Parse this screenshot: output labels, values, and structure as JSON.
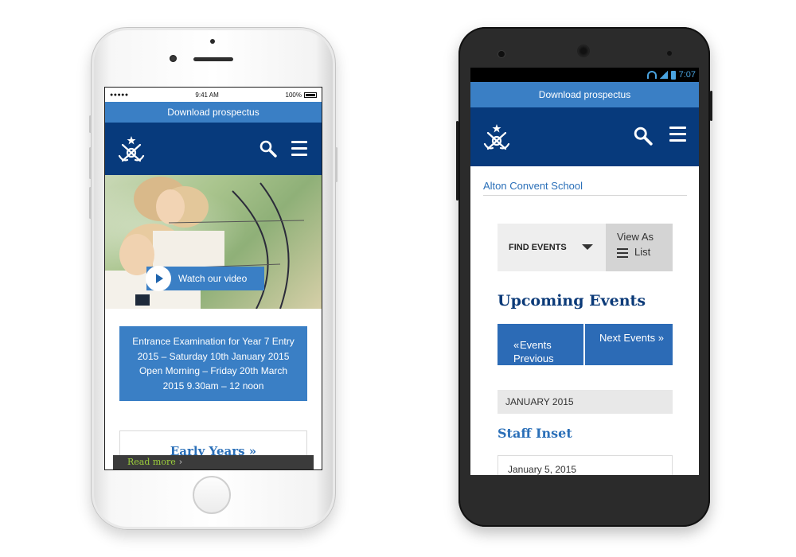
{
  "iphone": {
    "status": {
      "signal": "●●●●● ",
      "time": "9:41 AM",
      "battery": "100%"
    },
    "prospectus_label": "Download prospectus",
    "video_label": "Watch our video",
    "notice_lines": [
      "Entrance Examination for Year 7 Entry 2015 – Saturday 10th January 2015",
      "Open Morning – Friday 20th March 2015 9.30am – 12 noon"
    ],
    "early_years_label": "Early Years »",
    "read_more_label": "Read more",
    "read_more_arrow": "›"
  },
  "android": {
    "status": {
      "time": "7:07"
    },
    "prospectus_label": "Download prospectus",
    "school_name": "Alton Convent School",
    "find_events_label": "FIND EVENTS",
    "view_as_label": "View As",
    "list_label": "List",
    "upcoming_title": "Upcoming Events",
    "prev_label_1": "« Previous",
    "prev_label_2": "Events",
    "next_label": "Next Events »",
    "month_label": "JANUARY 2015",
    "event_title": "Staff Inset",
    "event_date": "January 5, 2015"
  },
  "colors": {
    "navy": "#073a7c",
    "accent_blue": "#3a7fc5",
    "link_blue": "#2a6fb8",
    "read_more_green": "#9ccf3a"
  },
  "icons": [
    "crest-logo-icon",
    "search-icon",
    "hamburger-menu-icon",
    "play-icon",
    "list-icon",
    "dropdown-arrow-icon"
  ]
}
